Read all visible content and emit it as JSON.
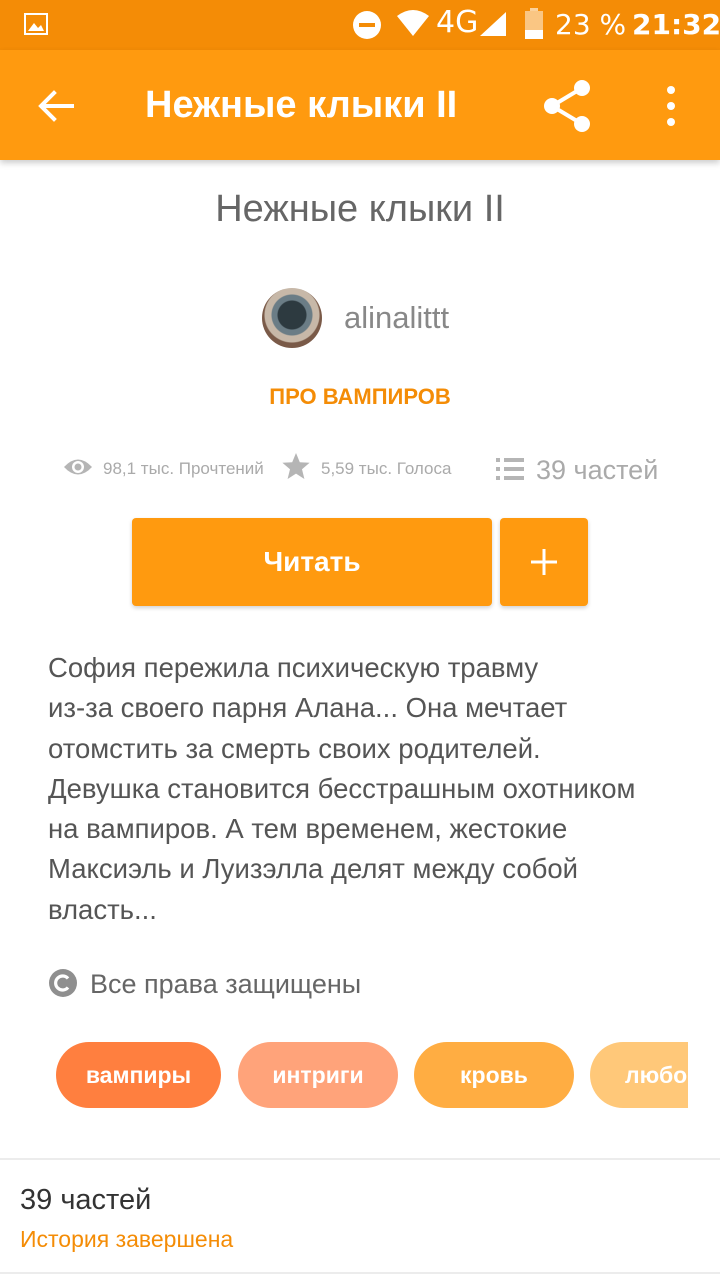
{
  "status_bar": {
    "network": "4G",
    "battery": "23 %",
    "time": "21:32",
    "icons": [
      "gallery-icon",
      "do-not-disturb-icon",
      "wifi-icon",
      "signal-icon",
      "battery-icon"
    ]
  },
  "app_bar": {
    "title": "Нежные клыки II",
    "icons": [
      "back-arrow-icon",
      "share-icon",
      "more-vert-icon"
    ]
  },
  "story": {
    "title": "Нежные клыки II",
    "author": "alinalittt",
    "category": "ПРО ВАМПИРОВ",
    "stats": {
      "reads": "98,1 тыс. Прочтений",
      "votes": "5,59 тыс. Голоса",
      "parts": "39 частей"
    },
    "read_button": "Читать",
    "add_button": "+",
    "description_lines": [
      "София пережила психическую травму",
      "из-за своего парня Алана... Она мечтает",
      "отомстить за смерть своих родителей.",
      "Девушка становится бесстрашным охотником",
      "на вампиров. А тем временем, жестокие",
      "Максиэль и Луизэлла делят между собой",
      "власть..."
    ],
    "copyright": "Все права защищены",
    "tags": [
      {
        "label": "вампиры",
        "color": "#ff7f3f"
      },
      {
        "label": "интриги",
        "color": "#ffa37a"
      },
      {
        "label": "кровь",
        "color": "#ffad42"
      },
      {
        "label": "любо",
        "color": "#ffc879"
      }
    ]
  },
  "parts_section": {
    "count": "39 частей",
    "status": "История завершена"
  },
  "colors": {
    "status_bar": "#f48c06",
    "app_bar": "#ff9a0f",
    "accent": "#f48c06",
    "muted_text": "#aaaaaa"
  }
}
